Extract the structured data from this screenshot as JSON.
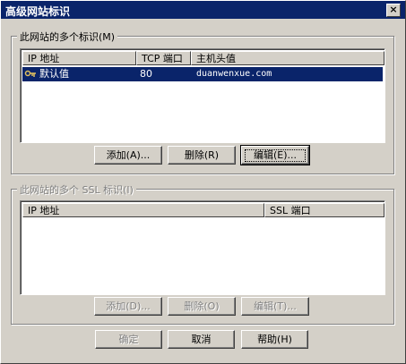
{
  "window": {
    "title": "高级网站标识",
    "close_glyph": "×"
  },
  "identities": {
    "group_label": "此网站的多个标识(M)",
    "columns": [
      "IP 地址",
      "TCP 端口",
      "主机头值"
    ],
    "rows": [
      {
        "ip": "默认值",
        "port": "80",
        "host": "duanwenxue.com",
        "selected": true
      }
    ],
    "buttons": {
      "add": "添加(A)...",
      "remove": "删除(R)",
      "edit": "编辑(E)..."
    }
  },
  "ssl": {
    "group_label": "此网站的多个 SSL 标识(I)",
    "columns": [
      "IP 地址",
      "SSL 端口"
    ],
    "rows": [],
    "buttons": {
      "add": "添加(D)...",
      "remove": "删除(O)",
      "edit": "编辑(T)..."
    }
  },
  "footer": {
    "ok": "确定",
    "cancel": "取消",
    "help": "帮助(H)"
  },
  "colors": {
    "face": "#d4d0c8",
    "title_bar": "#0a246a",
    "selection": "#0a246a"
  }
}
